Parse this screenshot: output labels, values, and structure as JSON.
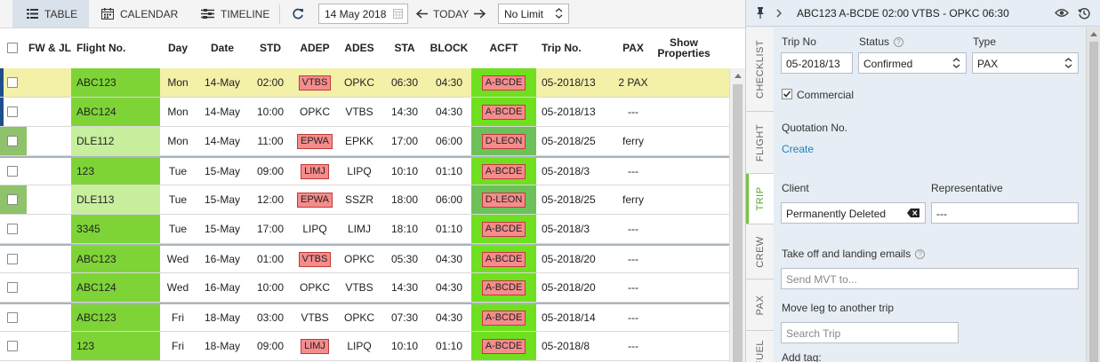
{
  "toolbar": {
    "table_label": "TABLE",
    "calendar_label": "CALENDAR",
    "timeline_label": "TIMELINE",
    "date_value": "14 May 2018",
    "today_label": "TODAY",
    "limit_value": "No Limit"
  },
  "table": {
    "headers": {
      "fwjl": "FW & JL",
      "flight": "Flight No.",
      "day": "Day",
      "date": "Date",
      "std": "STD",
      "adep": "ADEP",
      "ades": "ADES",
      "sta": "STA",
      "block": "BLOCK",
      "acft": "ACFT",
      "trip": "Trip No.",
      "pax": "PAX",
      "show_props_1": "Show",
      "show_props_2": "Properties"
    },
    "rows": [
      {
        "flight": "ABC123",
        "day": "Mon",
        "date": "14-May",
        "std": "02:00",
        "adep": "VTBS",
        "ades": "OPKC",
        "sta": "06:30",
        "block": "04:30",
        "acft": "A-BCDE",
        "trip": "05-2018/13",
        "pax": "2 PAX"
      },
      {
        "flight": "ABC124",
        "day": "Mon",
        "date": "14-May",
        "std": "10:00",
        "adep": "OPKC",
        "ades": "VTBS",
        "sta": "14:30",
        "block": "04:30",
        "acft": "A-BCDE",
        "trip": "05-2018/13",
        "pax": "---"
      },
      {
        "flight": "DLE112",
        "day": "Mon",
        "date": "14-May",
        "std": "11:00",
        "adep": "EPWA",
        "ades": "EPKK",
        "sta": "17:00",
        "block": "06:00",
        "acft": "D-LEON",
        "trip": "05-2018/25",
        "pax": "ferry"
      },
      {
        "flight": "123",
        "day": "Tue",
        "date": "15-May",
        "std": "09:00",
        "adep": "LIMJ",
        "ades": "LIPQ",
        "sta": "10:10",
        "block": "01:10",
        "acft": "A-BCDE",
        "trip": "05-2018/3",
        "pax": "---"
      },
      {
        "flight": "DLE113",
        "day": "Tue",
        "date": "15-May",
        "std": "12:00",
        "adep": "EPWA",
        "ades": "SSZR",
        "sta": "18:00",
        "block": "06:00",
        "acft": "D-LEON",
        "trip": "05-2018/25",
        "pax": "ferry"
      },
      {
        "flight": "3345",
        "day": "Tue",
        "date": "15-May",
        "std": "17:00",
        "adep": "LIPQ",
        "ades": "LIMJ",
        "sta": "18:10",
        "block": "01:10",
        "acft": "A-BCDE",
        "trip": "05-2018/3",
        "pax": "---"
      },
      {
        "flight": "ABC123",
        "day": "Wed",
        "date": "16-May",
        "std": "01:00",
        "adep": "VTBS",
        "ades": "OPKC",
        "sta": "05:30",
        "block": "04:30",
        "acft": "A-BCDE",
        "trip": "05-2018/20",
        "pax": "---"
      },
      {
        "flight": "ABC124",
        "day": "Wed",
        "date": "16-May",
        "std": "10:00",
        "adep": "OPKC",
        "ades": "VTBS",
        "sta": "14:30",
        "block": "04:30",
        "acft": "A-BCDE",
        "trip": "05-2018/20",
        "pax": "---"
      },
      {
        "flight": "ABC123",
        "day": "Fri",
        "date": "18-May",
        "std": "03:00",
        "adep": "VTBS",
        "ades": "OPKC",
        "sta": "07:30",
        "block": "04:30",
        "acft": "A-BCDE",
        "trip": "05-2018/14",
        "pax": "---"
      },
      {
        "flight": "123",
        "day": "Fri",
        "date": "18-May",
        "std": "09:00",
        "adep": "LIMJ",
        "ades": "LIPQ",
        "sta": "10:10",
        "block": "01:10",
        "acft": "A-BCDE",
        "trip": "05-2018/8",
        "pax": "---"
      }
    ]
  },
  "panel": {
    "title": "ABC123 A-BCDE 02:00 VTBS - OPKC 06:30",
    "tabs": [
      "CHECKLIST",
      "FLIGHT",
      "TRIP",
      "CREW",
      "PAX",
      "FUEL"
    ],
    "trip_no_label": "Trip No",
    "trip_no_value": "05-2018/13",
    "status_label": "Status",
    "status_value": "Confirmed",
    "type_label": "Type",
    "type_value": "PAX",
    "commercial_label": "Commercial",
    "quotation_label": "Quotation No.",
    "create_label": "Create",
    "client_label": "Client",
    "client_value": "Permanently Deleted",
    "representative_label": "Representative",
    "representative_value": "---",
    "emails_label": "Take off and landing emails",
    "emails_placeholder": "Send MVT to...",
    "move_leg_label": "Move leg to another trip",
    "search_trip_placeholder": "Search Trip",
    "add_tag_label": "Add tag:"
  },
  "colors": {
    "flight_green": "#7ed437",
    "flight_light_green": "#c7ef9d",
    "acft_green": "#6fe01f",
    "airport_red": "#f58c8c",
    "highlight_yellow": "#f3f0a8",
    "trip_tab_green": "#7ac142",
    "link_blue": "#1a82c4"
  },
  "icons": [
    "table-icon",
    "calendar-icon",
    "timeline-icon",
    "refresh-icon",
    "arrow-left-icon",
    "arrow-right-icon",
    "pin-icon",
    "chevron-right-icon",
    "eye-icon",
    "history-icon",
    "help-icon",
    "clear-icon"
  ]
}
